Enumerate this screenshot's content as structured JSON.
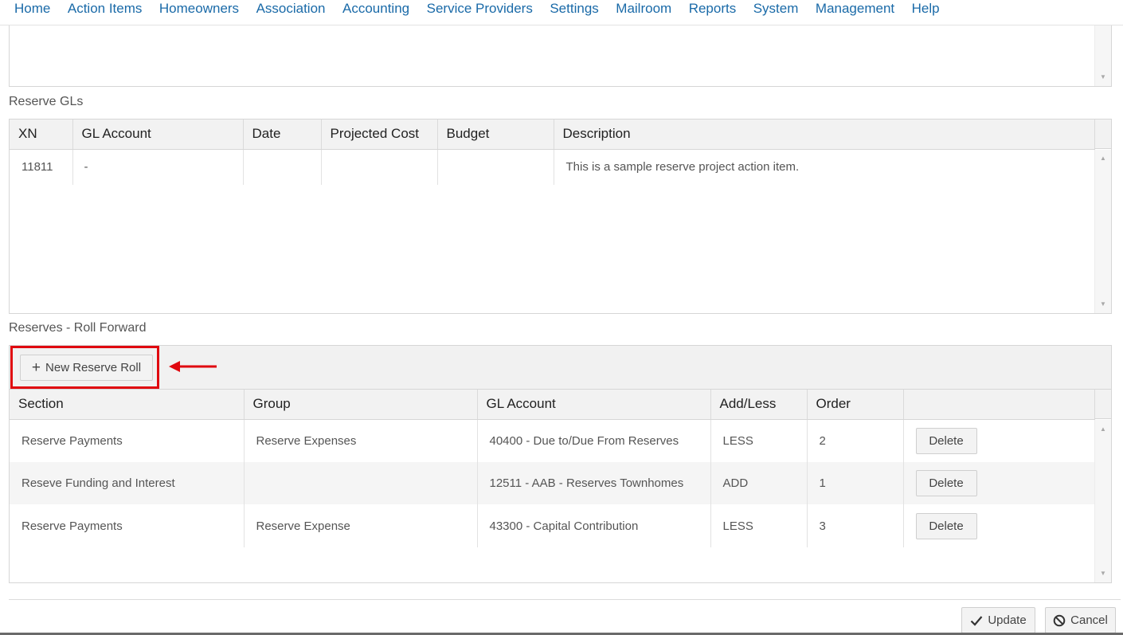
{
  "nav": {
    "items": [
      "Home",
      "Action Items",
      "Homeowners",
      "Association",
      "Accounting",
      "Service Providers",
      "Settings",
      "Mailroom",
      "Reports",
      "System",
      "Management",
      "Help"
    ]
  },
  "reserve_gls": {
    "title": "Reserve GLs",
    "columns": [
      "XN",
      "GL Account",
      "Date",
      "Projected Cost",
      "Budget",
      "Description"
    ],
    "rows": [
      {
        "xn": "11811",
        "gl_account": "-",
        "date": "",
        "projected_cost": "",
        "budget": "",
        "description": "This is a sample reserve project action item."
      }
    ]
  },
  "roll_forward": {
    "title": "Reserves - Roll Forward",
    "new_button_label": "New Reserve Roll",
    "columns": [
      "Section",
      "Group",
      "GL Account",
      "Add/Less",
      "Order",
      ""
    ],
    "rows": [
      {
        "section": "Reserve Payments",
        "group": "Reserve Expenses",
        "gl_account": "40400 - Due to/Due From Reserves",
        "add_less": "LESS",
        "order": "2",
        "action": "Delete"
      },
      {
        "section": "Reseve Funding and Interest",
        "group": "",
        "gl_account": "12511 - AAB - Reserves Townhomes",
        "add_less": "ADD",
        "order": "1",
        "action": "Delete"
      },
      {
        "section": "Reserve Payments",
        "group": "Reserve Expense",
        "gl_account": "43300 - Capital Contribution",
        "add_less": "LESS",
        "order": "3",
        "action": "Delete"
      }
    ]
  },
  "footer": {
    "update_label": "Update",
    "cancel_label": "Cancel"
  },
  "colors": {
    "nav_link": "#1a6aa8",
    "highlight": "#e0080f",
    "header_bg": "#f2f2f2",
    "alt_row_bg": "#f5f5f5"
  }
}
